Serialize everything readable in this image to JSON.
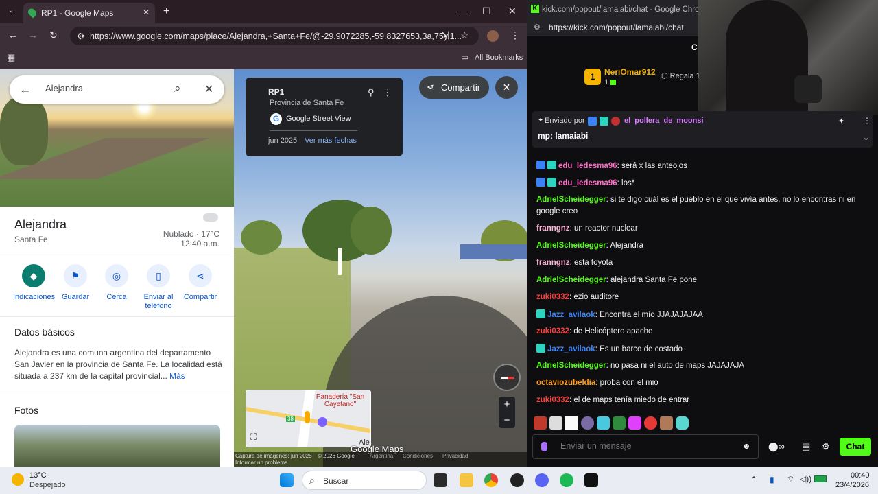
{
  "browser_left": {
    "tab_title": "RP1 - Google Maps",
    "url": "https://www.google.com/maps/place/Alejandra,+Santa+Fe/@-29.9072285,-59.8327653,3a,75y,1...",
    "all_bookmarks": "All Bookmarks"
  },
  "maps": {
    "search_value": "Alejandra",
    "place_name": "Alejandra",
    "place_region": "Santa Fe",
    "weather": "Nublado · 17°C",
    "time": "12:40 a.m.",
    "actions": [
      "Indicaciones",
      "Guardar",
      "Cerca",
      "Enviar al teléfono",
      "Compartir"
    ],
    "basics_title": "Datos básicos",
    "basics_text": "Alejandra es una comuna argentina del departamento San Javier en la provincia de Santa Fe. La localidad está situada a 237 km de la capital provincial...",
    "more": "Más",
    "photos_title": "Fotos"
  },
  "streetview": {
    "road": "RP1",
    "province": "Provincia de Santa Fe",
    "source": "Google Street View",
    "date": "jun 2025",
    "more_dates": "Ver más fechas",
    "share": "Compartir",
    "minimap_label": "Panadería \"San Cayetano\"",
    "minimap_route": "38",
    "minimap_partial": "Ale",
    "watermark": "Google Maps",
    "footer": [
      "Captura de imágenes: jun 2025",
      "© 2026 Google",
      "Argentina",
      "Condiciones",
      "Privacidad"
    ],
    "report": "Informar un problema"
  },
  "browser_right": {
    "title": "kick.com/popout/lamaiabi/chat - Google Chrome",
    "url": "https://kick.com/popout/lamaiabi/chat",
    "top_user": "NeriOmar912",
    "top_rank": "1",
    "top_count": "1",
    "gift": "Regala 1",
    "pinned_by": "Enviado por",
    "pinned_user": "el_pollera_de_moonsi",
    "pinned_msg": "mp: lamaiabi"
  },
  "chat": [
    {
      "user": "edu_ledesma96",
      "color": "#ff6ec7",
      "text": ": será x las anteojos",
      "badges": 2
    },
    {
      "user": "edu_ledesma96",
      "color": "#ff6ec7",
      "text": ": los*",
      "badges": 2
    },
    {
      "user": "AdrielScheidegger",
      "color": "#53fc18",
      "text": ": si te digo cuál es el pueblo en el que vivía antes, no lo encontras ni en",
      "badges": 0
    },
    {
      "user": "",
      "color": "#efeff1",
      "text": "google creo",
      "badges": 0
    },
    {
      "user": "franngnz",
      "color": "#ffb3d9",
      "text": ": un reactor nuclear",
      "badges": 0
    },
    {
      "user": "AdrielScheidegger",
      "color": "#53fc18",
      "text": ": Alejandra",
      "badges": 0
    },
    {
      "user": "franngnz",
      "color": "#ffb3d9",
      "text": ": esta toyota",
      "badges": 0
    },
    {
      "user": "AdrielScheidegger",
      "color": "#53fc18",
      "text": ": alejandra Santa Fe pone",
      "badges": 0
    },
    {
      "user": "zuki0332",
      "color": "#ff3b3b",
      "text": ": ezio auditore",
      "badges": 0
    },
    {
      "user": "Jazz_avilaok",
      "color": "#3b82f6",
      "text": ": Encontra el mío JJAJAJAJAA",
      "badges": 1
    },
    {
      "user": "zuki0332",
      "color": "#ff3b3b",
      "text": ": de Helicóptero apache",
      "badges": 0
    },
    {
      "user": "Jazz_avilaok",
      "color": "#3b82f6",
      "text": ": Es un barco de costado",
      "badges": 1
    },
    {
      "user": "AdrielScheidegger",
      "color": "#53fc18",
      "text": ": no pasa ni el auto de maps JAJAJAJA",
      "badges": 0
    },
    {
      "user": "octaviozubeldia",
      "color": "#ff9f1a",
      "text": ": proba con el mio",
      "badges": 0
    },
    {
      "user": "zuki0332",
      "color": "#ff3b3b",
      "text": ": el de maps tenía miedo de entrar",
      "badges": 0
    }
  ],
  "chat_input": {
    "placeholder": "Enviar un mensaje",
    "send": "Chat"
  },
  "taskbar": {
    "weather_temp": "13°C",
    "weather_desc": "Despejado",
    "search": "Buscar",
    "time": "00:40",
    "date": "23/4/2026"
  }
}
